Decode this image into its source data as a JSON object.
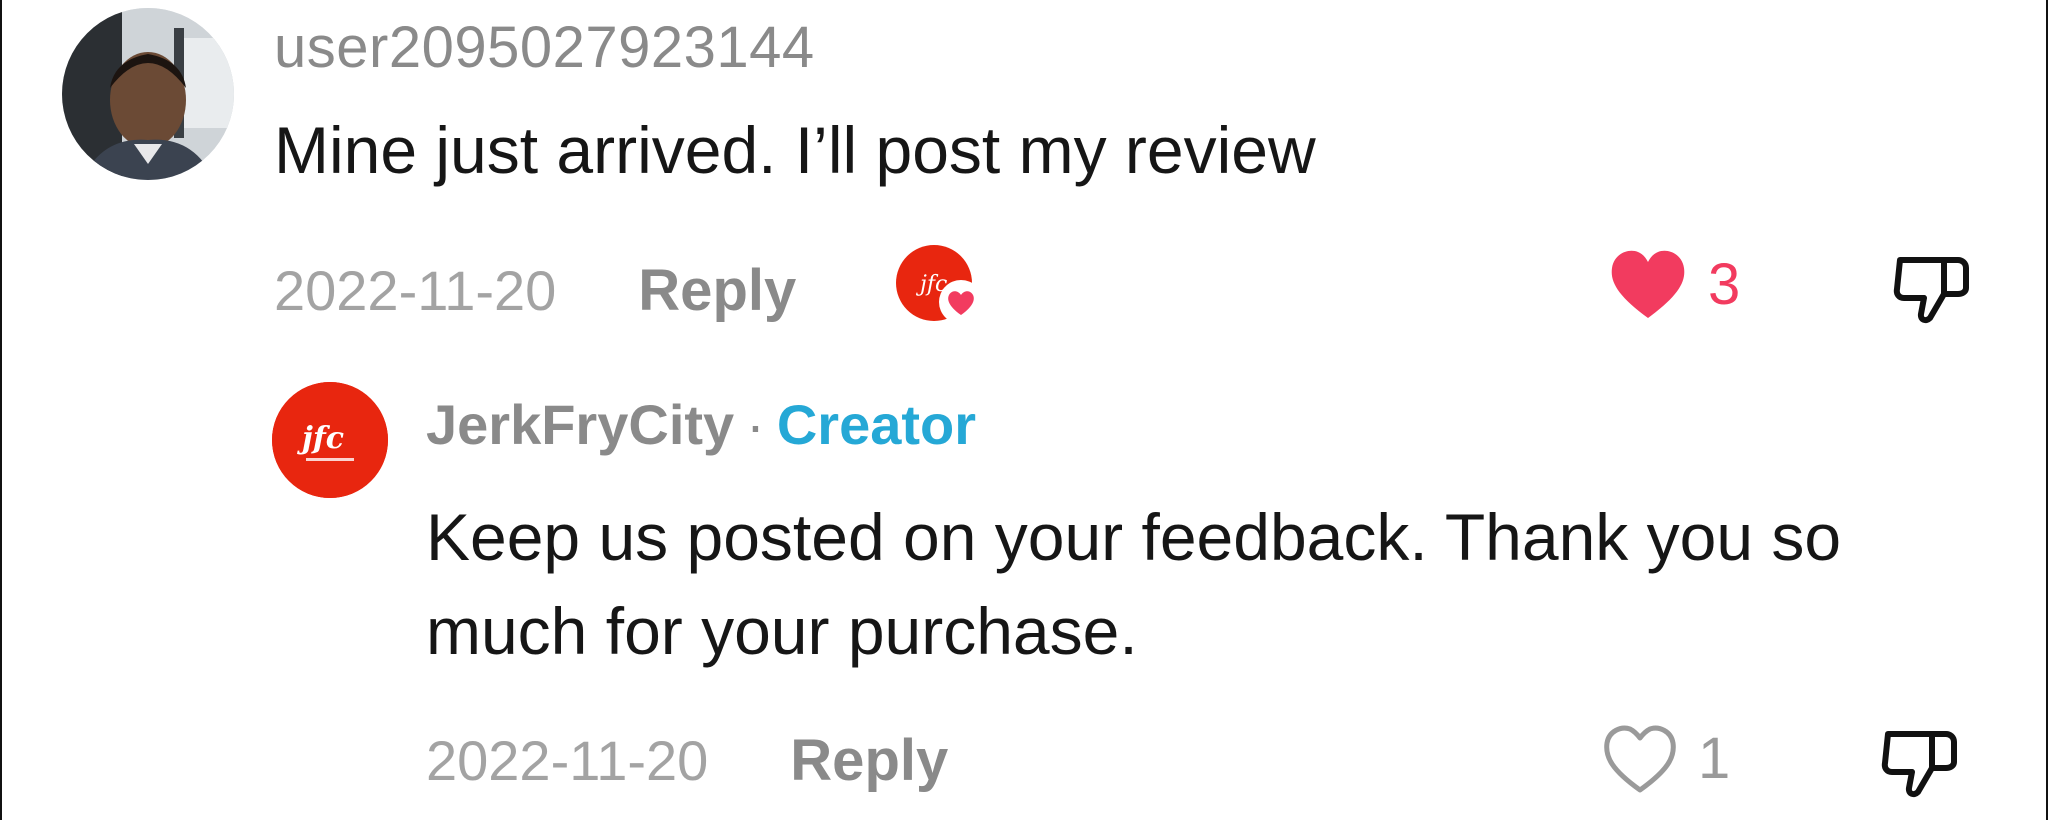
{
  "comment": {
    "username": "user2095027923144",
    "text": "Mine just arrived. I’ll post my review",
    "date": "2022-11-20",
    "reply_label": "Reply",
    "like_count": "3",
    "liked": true,
    "liked_by_creator": true
  },
  "reply": {
    "username": "JerkFryCity",
    "separator": "·",
    "badge": "Creator",
    "text": "Keep us posted on your feedback. Thank you so much for your purchase.",
    "date": "2022-11-20",
    "reply_label": "Reply",
    "like_count": "1",
    "liked": false
  },
  "colors": {
    "like_active": "#f23b5f",
    "creator_badge": "#25a8d6",
    "brand_red": "#e8260f",
    "muted_text": "#8a8a8a"
  },
  "icons": [
    "avatar-photo",
    "creator-logo",
    "heart-icon",
    "dislike-icon"
  ]
}
